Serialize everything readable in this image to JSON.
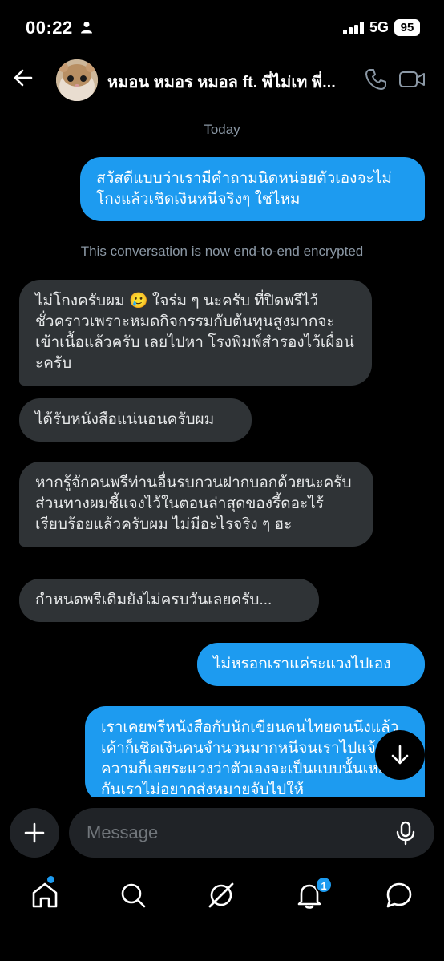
{
  "status_bar": {
    "time": "00:22",
    "network": "5G",
    "battery": "95"
  },
  "header": {
    "title": "หมอน หมอร หมอล ft. พี่ไม่เท พี่..."
  },
  "conversation": {
    "date_label": "Today",
    "encryption_notice": "This conversation is now end-to-end encrypted",
    "messages": [
      {
        "direction": "outgoing",
        "text": "สวัสดีแบบว่าเรามีคำถามนิดหน่อยตัวเองจะไม่โกงแล้วเชิดเงินหนีจริงๆ ใช่ไหม"
      },
      {
        "direction": "incoming",
        "text": "ไม่โกงครับผม 🥲 ใจร่ม ๆ นะครับ ที่ปิดพรีไว้ชั่วคราวเพราะหมดกิจกรรมกับต้นทุนสูงมากจะเข้าเนื้อแล้วครับ เลยไปหา โรงพิมพ์สำรองไว้เผื่อน่ะครับ"
      },
      {
        "direction": "incoming",
        "text": "ได้รับหนังสือแน่นอนครับผม"
      },
      {
        "direction": "incoming",
        "text": "หากรู้จักคนพรีท่านอื่นรบกวนฝากบอกด้วยนะครับ ส่วนทางผมชี้แจงไว้ในตอนล่าสุดของรี้ดอะไร้เรียบร้อยแล้วครับผม ไม่มีอะไรจริง ๆ ฮะ"
      },
      {
        "direction": "incoming",
        "text": "กำหนดพรีเดิมยังไม่ครบวันเลยครับ..."
      },
      {
        "direction": "outgoing",
        "text": "ไม่หรอกเราแค่ระแวงไปเอง"
      },
      {
        "direction": "outgoing",
        "text": "เราเคยพรีหนังสือกับนักเขียนคนไทยคนนึงแล้วเค้าก็เชิดเงินคนจำนวนมากหนีจนเราไปแจ้งความก็เลยระแวงว่าตัวเองจะเป็นแบบนั้นเหมือนกันเราไม่อยากส่งหมายจับไปให้"
      }
    ]
  },
  "composer": {
    "placeholder": "Message"
  },
  "tab_bar": {
    "items": [
      {
        "name": "home",
        "icon": "home-icon"
      },
      {
        "name": "search",
        "icon": "search-icon"
      },
      {
        "name": "grok",
        "icon": "grok-icon"
      },
      {
        "name": "notifications",
        "icon": "bell-icon",
        "badge": "1"
      },
      {
        "name": "messages",
        "icon": "messages-icon"
      }
    ]
  },
  "colors": {
    "background": "#000000",
    "incoming_bubble": "#2f3336",
    "outgoing_bubble": "#1d9bf0",
    "muted_text": "#8b98a5",
    "accent": "#1d9bf0"
  }
}
